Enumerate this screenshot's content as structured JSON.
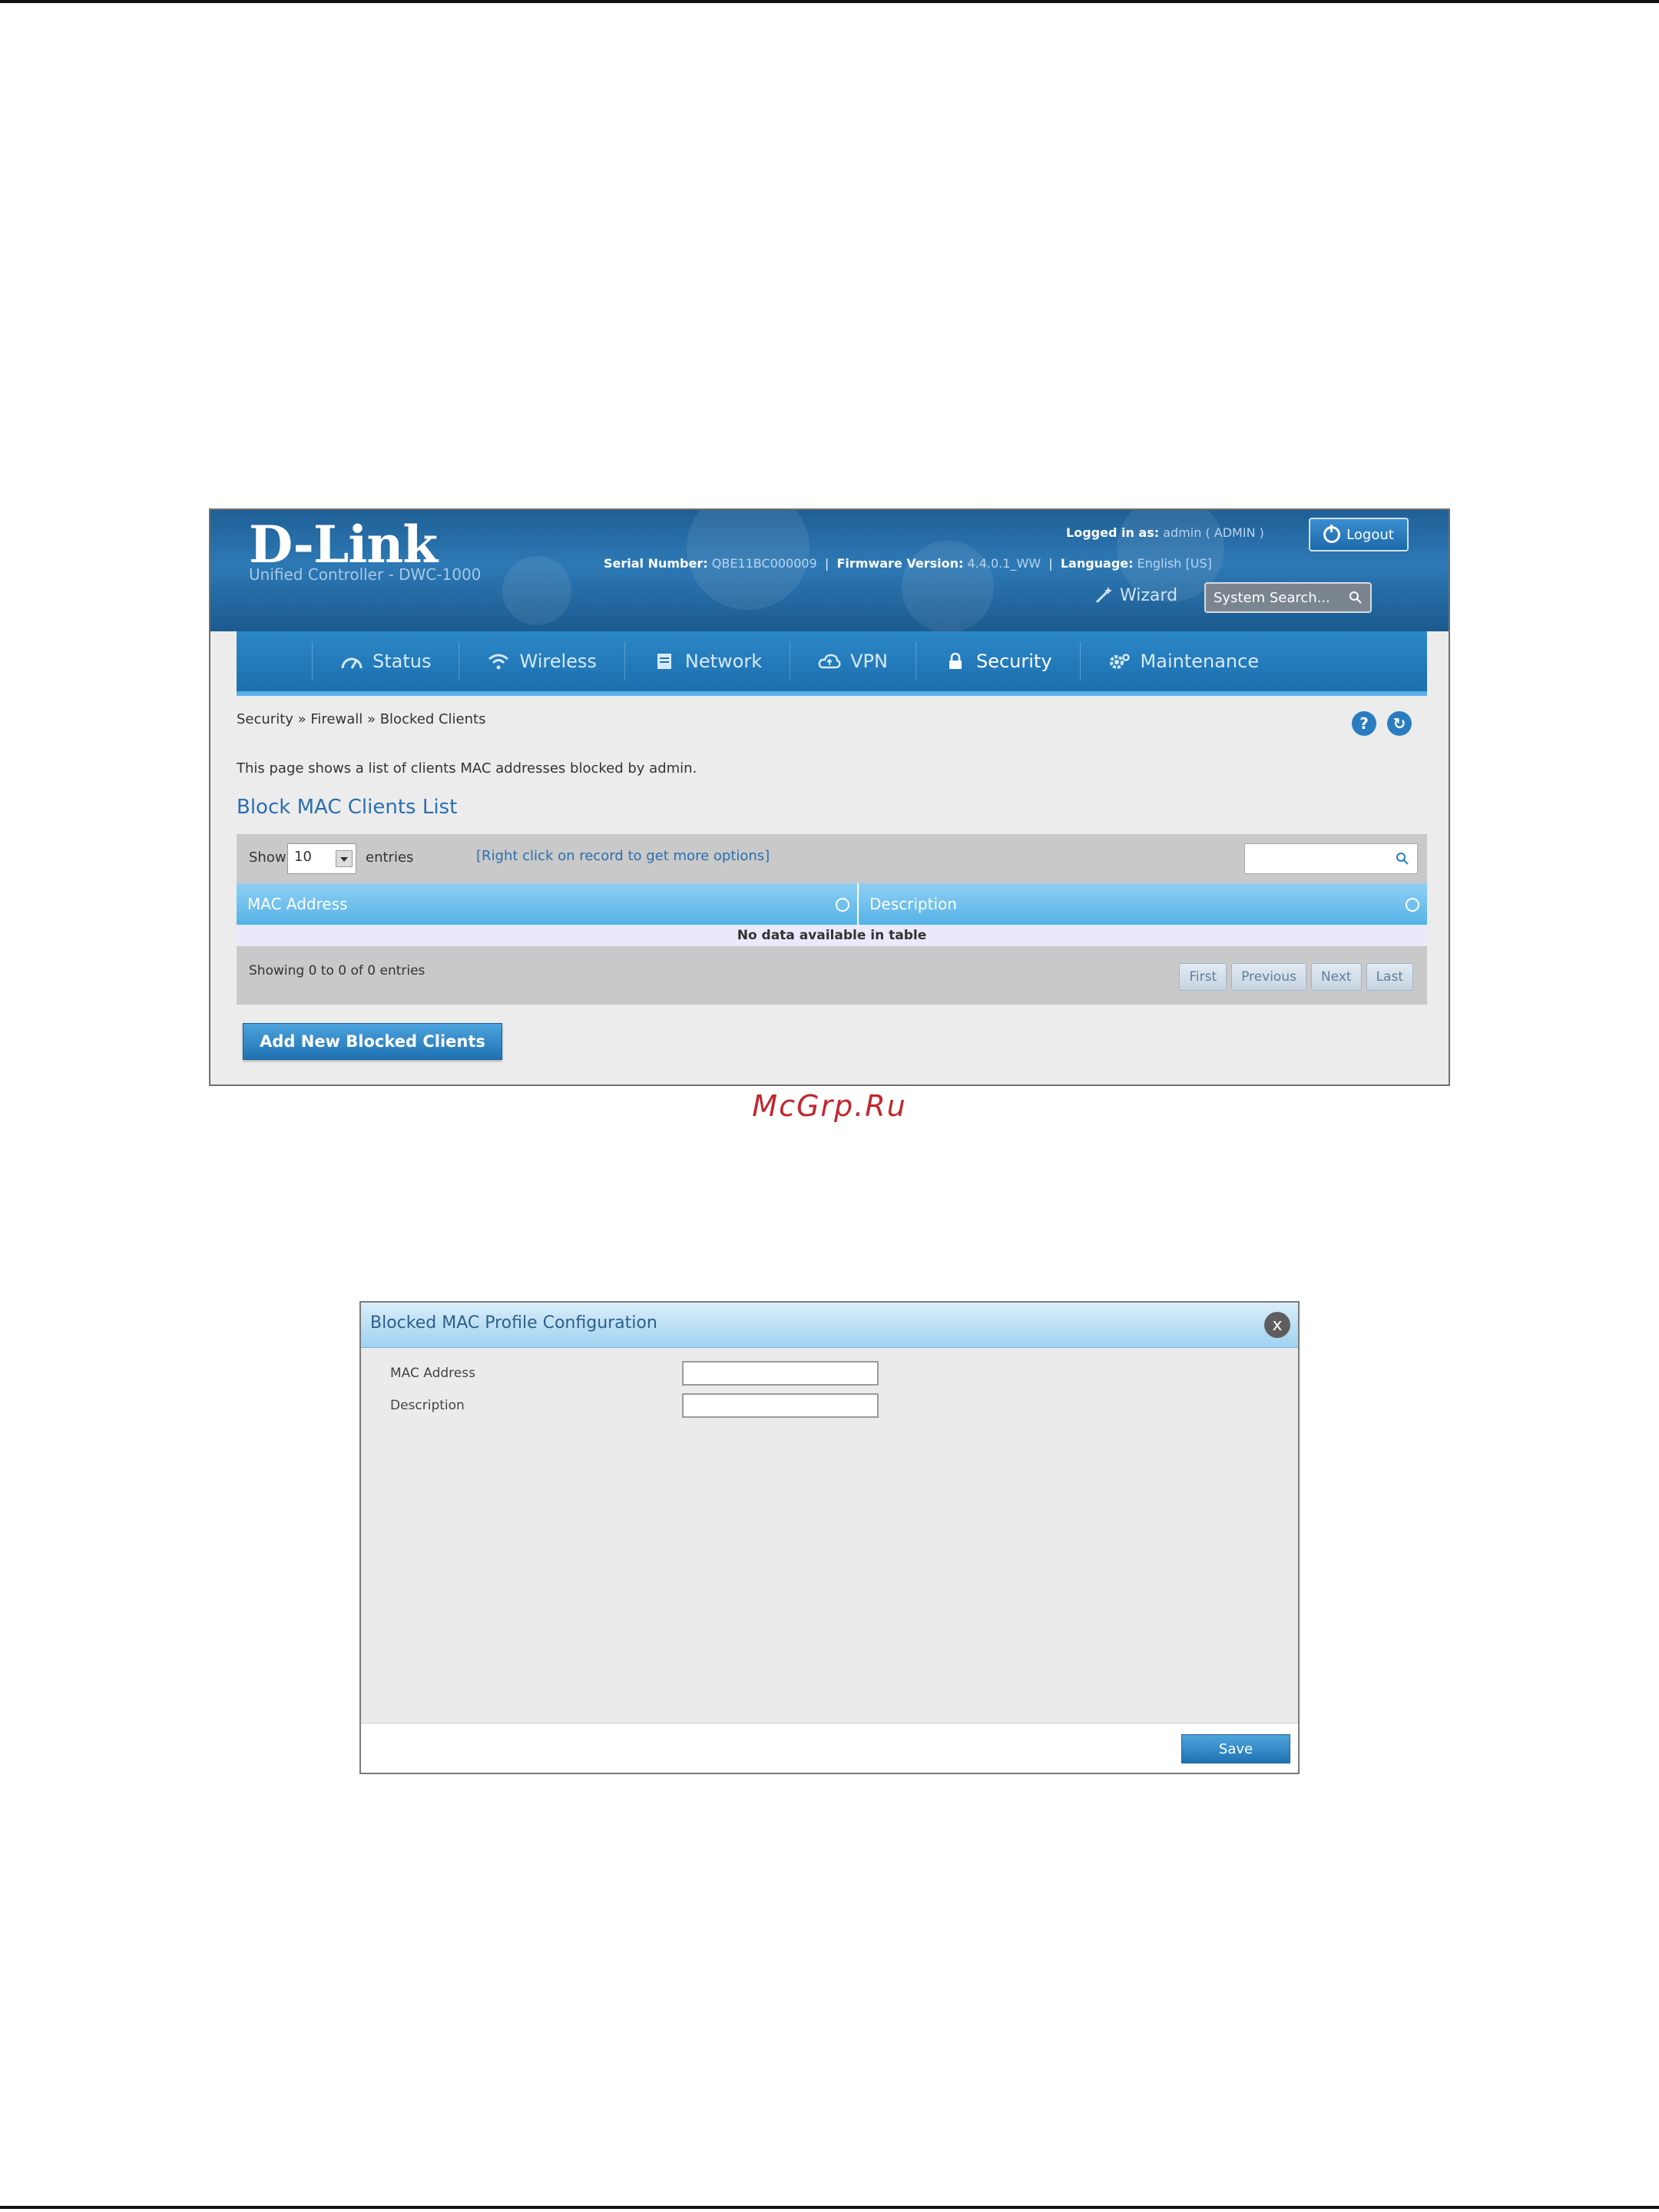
{
  "screenshot1": {
    "header": {
      "logo": "D-Link",
      "logo_subtitle": "Unified Controller - DWC-1000",
      "serial_label": "Serial Number:",
      "serial_value": "QBE11BC000009",
      "firmware_label": "Firmware Version:",
      "firmware_value": "4.4.0.1_WW",
      "logged_in_label": "Logged in as:",
      "logged_in_value": "admin ( ADMIN )",
      "language_label": "Language:",
      "language_value": "English [US]",
      "logout_label": "Logout",
      "wizard_label": "Wizard",
      "system_search_placeholder": "System Search..."
    },
    "nav": [
      {
        "label": "Status",
        "icon": "gauge-icon"
      },
      {
        "label": "Wireless",
        "icon": "wifi-icon"
      },
      {
        "label": "Network",
        "icon": "network-icon"
      },
      {
        "label": "VPN",
        "icon": "cloud-icon"
      },
      {
        "label": "Security",
        "icon": "lock-icon",
        "active": true
      },
      {
        "label": "Maintenance",
        "icon": "gear-icon"
      }
    ],
    "breadcrumb": "Security  »  Firewall  »  Blocked Clients",
    "description": "This page shows a list of clients MAC addresses blocked by admin.",
    "section_title": "Block MAC Clients List",
    "table": {
      "show_label": "Show",
      "entries_value": "10",
      "entries_label": "entries",
      "hint": "[Right click on record to get more options]",
      "columns": [
        "MAC Address",
        "Description"
      ],
      "empty_message": "No data available in table",
      "showing_text": "Showing 0 to 0 of 0 entries",
      "pager": [
        "First",
        "Previous",
        "Next",
        "Last"
      ]
    },
    "add_button": "Add New Blocked Clients"
  },
  "watermark": "McGrp.Ru",
  "screenshot2": {
    "title": "Blocked MAC Profile Configuration",
    "close_label": "x",
    "fields": [
      {
        "label": "MAC Address",
        "value": ""
      },
      {
        "label": "Description",
        "value": ""
      }
    ],
    "save_label": "Save"
  }
}
